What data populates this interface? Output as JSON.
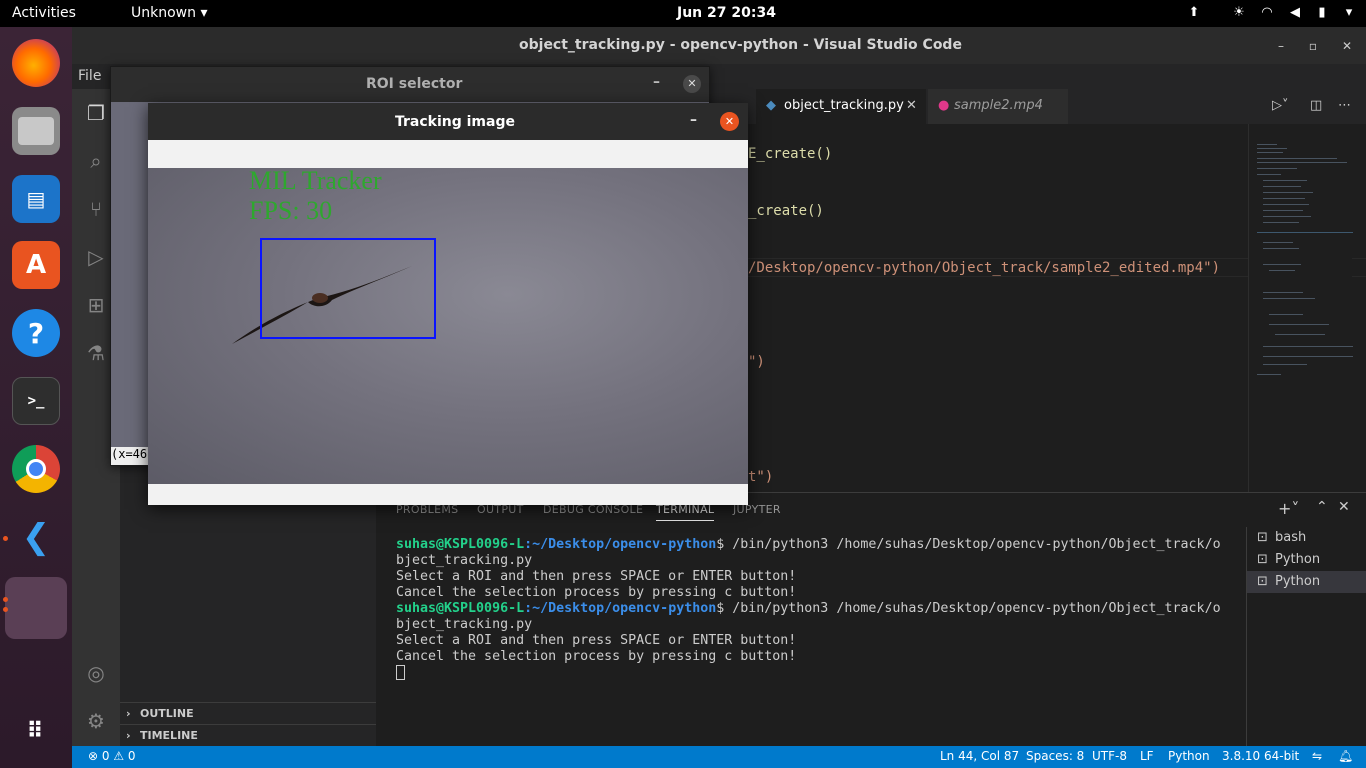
{
  "topbar": {
    "activities": "Activities",
    "app_menu": "Unknown ▾",
    "clock": "Jun 27  20:34"
  },
  "vscode": {
    "title": "object_tracking.py - opencv-python - Visual Studio Code",
    "menu_file": "File",
    "tabs": [
      {
        "label": "object_tracking.py",
        "active": true
      },
      {
        "label": "sample2.mp4",
        "active": false
      }
    ],
    "code_fragments": [
      "E_create()",
      "_create()",
      "/Desktop/opencv-python/Object_track/sample2_edited.mp4\")",
      "\")",
      "t\")"
    ],
    "sidebar_sections": [
      "OUTLINE",
      "TIMELINE"
    ],
    "panel_tabs": [
      "PROBLEMS",
      "OUTPUT",
      "DEBUG CONSOLE",
      "TERMINAL",
      "JUPYTER"
    ],
    "terminal": {
      "user": "suhas@KSPL0096-L",
      "path": ":~/Desktop/opencv-python",
      "command": "$ /bin/python3 /home/suhas/Desktop/opencv-python/Object_track/o",
      "command_wrap": "bject_tracking.py",
      "line1": "Select a ROI and then press SPACE or ENTER button!",
      "line2": "Cancel the selection process by pressing c button!"
    },
    "terminal_list": [
      "bash",
      "Python",
      "Python"
    ],
    "status": {
      "problems": "⊗ 0 ⚠ 0",
      "position": "Ln 44, Col 87",
      "spaces": "Spaces: 8",
      "encoding": "UTF-8",
      "eol": "LF",
      "language": "Python",
      "interpreter": "3.8.10 64-bit"
    }
  },
  "roi_window": {
    "title": "ROI selector",
    "status": "(x=46"
  },
  "tracking_window": {
    "title": "Tracking image",
    "tracker_label": "MIL Tracker",
    "fps_label": "FPS: 30"
  },
  "colors": {
    "vscode_blue": "#007acc",
    "terminal_user": "#23d18b",
    "terminal_path": "#3b8eea",
    "tracker_text": "#2ea82e",
    "bbox": "#0a14ff",
    "close_button": "#e95420"
  }
}
